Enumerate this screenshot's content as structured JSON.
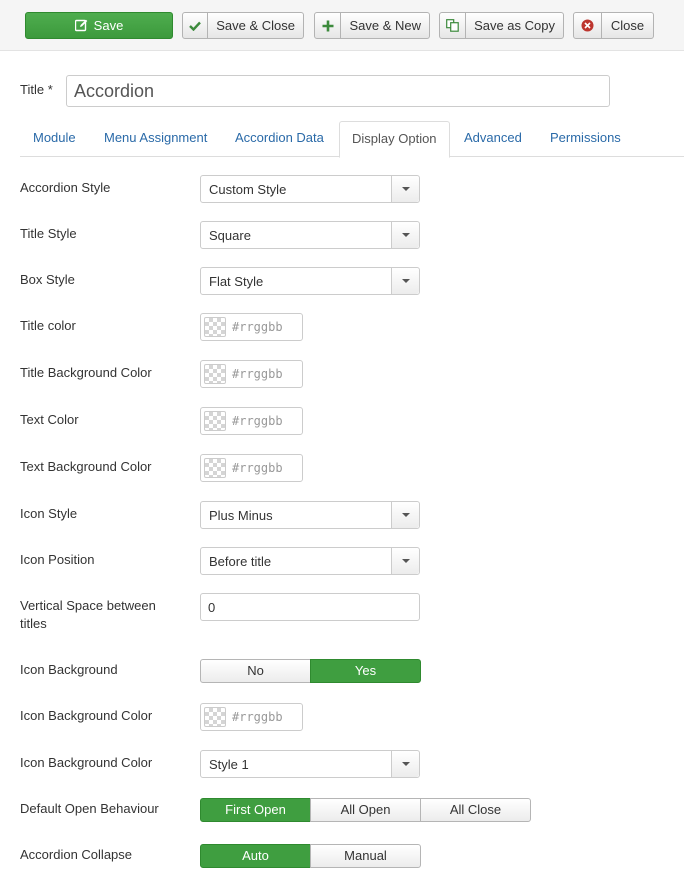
{
  "toolbar": {
    "save": "Save",
    "save_close": "Save & Close",
    "save_new": "Save & New",
    "save_copy": "Save as Copy",
    "close": "Close"
  },
  "title": {
    "label": "Title *",
    "value": "Accordion"
  },
  "tabs": [
    "Module",
    "Menu Assignment",
    "Accordion Data",
    "Display Option",
    "Advanced",
    "Permissions"
  ],
  "active_tab": "Display Option",
  "fields": {
    "accordion_style": {
      "label": "Accordion Style",
      "value": "Custom Style"
    },
    "title_style": {
      "label": "Title Style",
      "value": "Square"
    },
    "box_style": {
      "label": "Box Style",
      "value": "Flat Style"
    },
    "title_color": {
      "label": "Title color",
      "placeholder": "#rrggbb"
    },
    "title_bg_color": {
      "label": "Title Background Color",
      "placeholder": "#rrggbb"
    },
    "text_color": {
      "label": "Text Color",
      "placeholder": "#rrggbb"
    },
    "text_bg_color": {
      "label": "Text Background Color",
      "placeholder": "#rrggbb"
    },
    "icon_style": {
      "label": "Icon Style",
      "value": "Plus Minus"
    },
    "icon_position": {
      "label": "Icon Position",
      "value": "Before title"
    },
    "vertical_space": {
      "label": "Vertical Space between titles",
      "value": "0"
    },
    "icon_background": {
      "label": "Icon Background",
      "options": [
        "No",
        "Yes"
      ],
      "selected": "Yes"
    },
    "icon_bg_color": {
      "label": "Icon Background Color",
      "placeholder": "#rrggbb"
    },
    "icon_bg_color_style": {
      "label": "Icon Background Color",
      "value": "Style 1"
    },
    "default_open": {
      "label": "Default Open Behaviour",
      "options": [
        "First Open",
        "All Open",
        "All Close"
      ],
      "selected": "First Open"
    },
    "accordion_collapse": {
      "label": "Accordion Collapse",
      "options": [
        "Auto",
        "Manual"
      ],
      "selected": "Auto"
    }
  },
  "colors": {
    "save_green": "#3f9e40",
    "link_blue": "#2a6aa8",
    "close_red": "#bd362f"
  }
}
